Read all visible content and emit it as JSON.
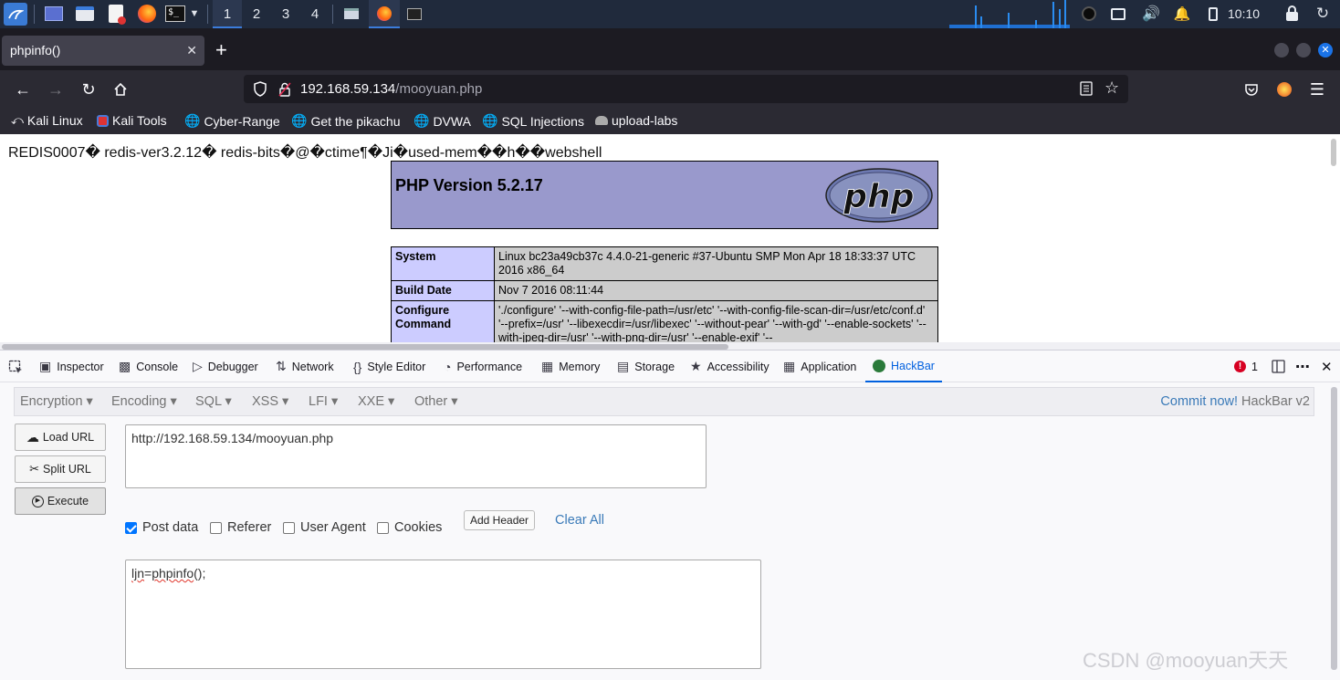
{
  "taskbar": {
    "workspaces": [
      "1",
      "2",
      "3",
      "4"
    ],
    "active_workspace": "1",
    "clock": "10:10"
  },
  "browser": {
    "tab_title": "phpinfo()",
    "url_host": "192.168.59.134",
    "url_path": "/mooyuan.php"
  },
  "bookmarks": [
    "Kali Linux",
    "Kali Tools",
    "Cyber-Range",
    "Get the pikachu",
    "DVWA",
    "SQL Injections",
    "upload-labs"
  ],
  "page": {
    "redis_line": "REDIS0007� redis-ver3.2.12� redis-bits�@�ctime¶�Ji�used-mem��h��webshell",
    "php_version": "PHP Version 5.2.17",
    "logo_text": "php",
    "rows": [
      {
        "key": "System",
        "value": "Linux bc23a49cb37c 4.4.0-21-generic #37-Ubuntu SMP Mon Apr 18 18:33:37 UTC 2016 x86_64"
      },
      {
        "key": "Build Date",
        "value": "Nov 7 2016 08:11:44"
      },
      {
        "key": "Configure Command",
        "value": "'./configure' '--with-config-file-path=/usr/etc' '--with-config-file-scan-dir=/usr/etc/conf.d' '--prefix=/usr' '--libexecdir=/usr/libexec' '--without-pear' '--with-gd' '--enable-sockets' '--with-jpeg-dir=/usr' '--with-png-dir=/usr' '--enable-exif' '--"
      }
    ]
  },
  "devtools": {
    "tabs": [
      "Inspector",
      "Console",
      "Debugger",
      "Network",
      "Style Editor",
      "Performance",
      "Memory",
      "Storage",
      "Accessibility",
      "Application",
      "HackBar"
    ],
    "active_tab": "HackBar",
    "error_count": "1"
  },
  "hackbar": {
    "menu": [
      "Encryption",
      "Encoding",
      "SQL",
      "XSS",
      "LFI",
      "XXE",
      "Other"
    ],
    "commit_link": "Commit now!",
    "commit_suffix": "HackBar v2",
    "load_url": "Load URL",
    "split_url": "Split URL",
    "execute": "Execute",
    "url_value": "http://192.168.59.134/mooyuan.php",
    "options": [
      {
        "label": "Post data",
        "checked": true
      },
      {
        "label": "Referer",
        "checked": false
      },
      {
        "label": "User Agent",
        "checked": false
      },
      {
        "label": "Cookies",
        "checked": false
      }
    ],
    "add_header": "Add Header",
    "clear_all": "Clear All",
    "post_data_key": "ljn",
    "post_data_eq": "=",
    "post_data_val": "phpinfo",
    "post_data_tail": "();"
  },
  "watermark": "CSDN @mooyuan天天",
  "colors": {
    "php_header_bg": "#9999cc",
    "php_key_bg": "#ccccff",
    "php_value_bg": "#cccccc",
    "devtools_accent": "#0060df"
  }
}
